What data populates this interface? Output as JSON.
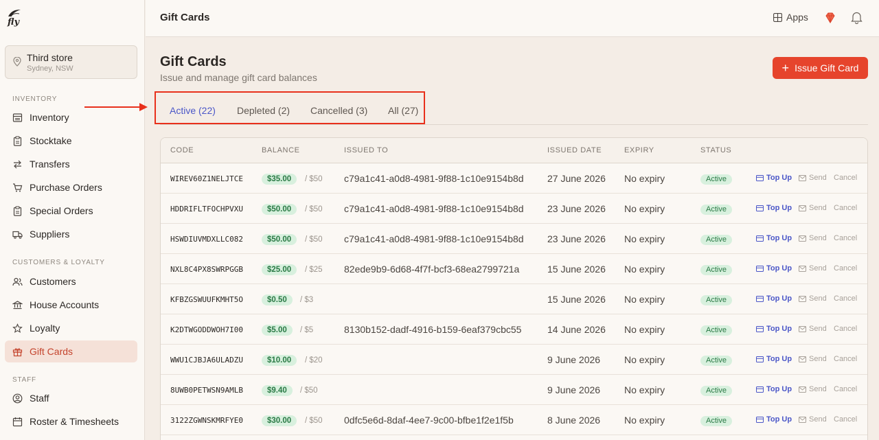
{
  "brand": {
    "logo_text": "fly"
  },
  "store": {
    "name": "Third store",
    "location": "Sydney, NSW"
  },
  "sidebar": {
    "sections": [
      {
        "label": "INVENTORY"
      },
      {
        "label": "CUSTOMERS & LOYALTY"
      },
      {
        "label": "STAFF"
      }
    ],
    "items": [
      {
        "label": "Inventory",
        "icon": "inventory-icon"
      },
      {
        "label": "Stocktake",
        "icon": "clipboard-icon"
      },
      {
        "label": "Transfers",
        "icon": "transfer-arrows-icon"
      },
      {
        "label": "Purchase Orders",
        "icon": "cart-icon"
      },
      {
        "label": "Special Orders",
        "icon": "clipboard-icon"
      },
      {
        "label": "Suppliers",
        "icon": "truck-icon"
      },
      {
        "label": "Customers",
        "icon": "users-icon"
      },
      {
        "label": "House Accounts",
        "icon": "bank-icon"
      },
      {
        "label": "Loyalty",
        "icon": "star-icon"
      },
      {
        "label": "Gift Cards",
        "icon": "gift-icon",
        "active": true
      },
      {
        "label": "Staff",
        "icon": "user-circle-icon"
      },
      {
        "label": "Roster & Timesheets",
        "icon": "calendar-icon"
      }
    ]
  },
  "topbar": {
    "title": "Gift Cards",
    "apps_label": "Apps"
  },
  "header": {
    "title": "Gift Cards",
    "subtitle": "Issue and manage gift card balances",
    "issue_button": "Issue Gift Card"
  },
  "tabs": [
    {
      "label": "Active (22)",
      "active": true
    },
    {
      "label": "Depleted (2)"
    },
    {
      "label": "Cancelled (3)"
    },
    {
      "label": "All (27)"
    }
  ],
  "table": {
    "columns": [
      "CODE",
      "BALANCE",
      "ISSUED TO",
      "ISSUED DATE",
      "EXPIRY",
      "STATUS"
    ],
    "actions": {
      "top_up": "Top Up",
      "send": "Send",
      "cancel": "Cancel"
    },
    "rows": [
      {
        "code": "WIREV60Z1NELJTCE",
        "balance": "$35.00",
        "of": "/ $50",
        "issued_to": "c79a1c41-a0d8-4981-9f88-1c10e9154b8d",
        "date": "27 June 2026",
        "expiry": "No expiry",
        "status": "Active"
      },
      {
        "code": "HDDRIFLTFOCHPVXU",
        "balance": "$50.00",
        "of": "/ $50",
        "issued_to": "c79a1c41-a0d8-4981-9f88-1c10e9154b8d",
        "date": "23 June 2026",
        "expiry": "No expiry",
        "status": "Active"
      },
      {
        "code": "HSWDIUVMDXLLC082",
        "balance": "$50.00",
        "of": "/ $50",
        "issued_to": "c79a1c41-a0d8-4981-9f88-1c10e9154b8d",
        "date": "23 June 2026",
        "expiry": "No expiry",
        "status": "Active"
      },
      {
        "code": "NXL8C4PX8SWRPGGB",
        "balance": "$25.00",
        "of": "/ $25",
        "issued_to": "82ede9b9-6d68-4f7f-bcf3-68ea2799721a",
        "date": "15 June 2026",
        "expiry": "No expiry",
        "status": "Active"
      },
      {
        "code": "KFBZGSWUUFKMHT5O",
        "balance": "$0.50",
        "of": "/ $3",
        "issued_to": "",
        "date": "15 June 2026",
        "expiry": "No expiry",
        "status": "Active"
      },
      {
        "code": "K2DTWGODDWOH7I00",
        "balance": "$5.00",
        "of": "/ $5",
        "issued_to": "8130b152-dadf-4916-b159-6eaf379cbc55",
        "date": "14 June 2026",
        "expiry": "No expiry",
        "status": "Active"
      },
      {
        "code": "WWU1CJBJA6ULADZU",
        "balance": "$10.00",
        "of": "/ $20",
        "issued_to": "",
        "date": "9 June 2026",
        "expiry": "No expiry",
        "status": "Active"
      },
      {
        "code": "8UWB0PETWSN9AMLB",
        "balance": "$9.40",
        "of": "/ $50",
        "issued_to": "",
        "date": "9 June 2026",
        "expiry": "No expiry",
        "status": "Active"
      },
      {
        "code": "3122ZGWNSKMRFYE0",
        "balance": "$30.00",
        "of": "/ $50",
        "issued_to": "0dfc5e6d-8daf-4ee7-9c00-bfbe1f2e1f5b",
        "date": "8 June 2026",
        "expiry": "No expiry",
        "status": "Active"
      }
    ]
  },
  "colors": {
    "accent": "#e6442c",
    "tab_active": "#4a56c8",
    "status_green": "#2a7a45",
    "highlight_red": "#e8301b"
  }
}
